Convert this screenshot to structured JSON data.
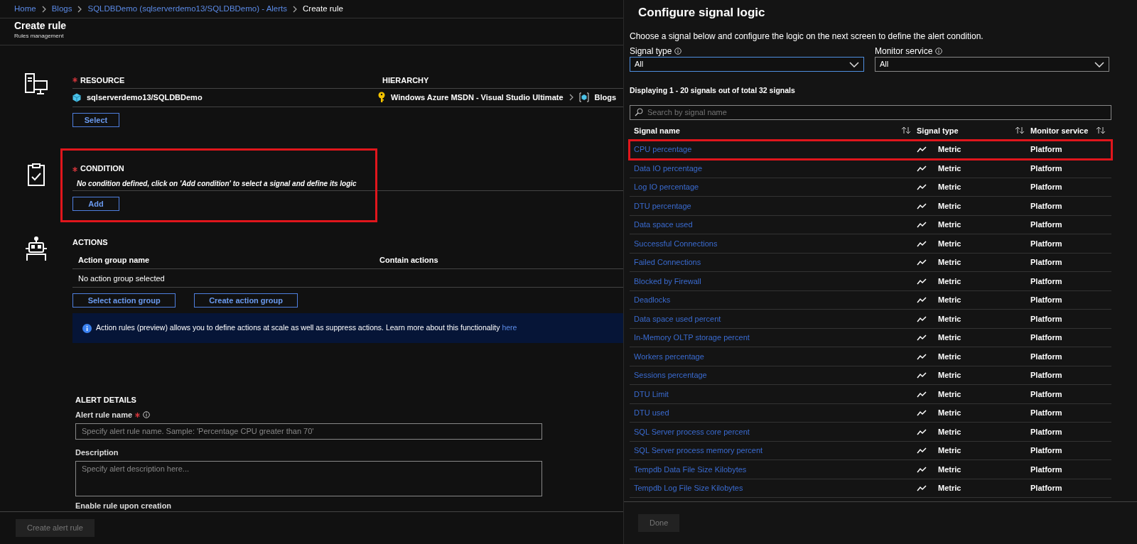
{
  "breadcrumb": [
    {
      "label": "Home",
      "current": false
    },
    {
      "label": "Blogs",
      "current": false
    },
    {
      "label": "SQLDBDemo (sqlserverdemo13/SQLDBDemo) - Alerts",
      "current": false
    },
    {
      "label": "Create rule",
      "current": true
    }
  ],
  "page": {
    "title": "Create rule",
    "subtitle": "Rules management"
  },
  "resource": {
    "heading": "RESOURCE",
    "required": true,
    "hierarchy_heading": "HIERARCHY",
    "name": "sqlserverdemo13/SQLDBDemo",
    "hierarchy": [
      "Windows Azure MSDN - Visual Studio Ultimate",
      "Blogs"
    ],
    "button": "Select"
  },
  "condition": {
    "heading": "CONDITION",
    "required": true,
    "message": "No condition defined, click on 'Add condition' to select a signal and define its logic",
    "button": "Add",
    "highlighted": true
  },
  "actions": {
    "heading": "ACTIONS",
    "columns": [
      "Action group name",
      "Contain actions"
    ],
    "empty": "No action group selected",
    "buttons": [
      "Select action group",
      "Create action group"
    ],
    "info": {
      "text": "Action rules (preview) allows you to define actions at scale as well as suppress actions. Learn more about this functionality",
      "link": "here"
    }
  },
  "alert_details": {
    "heading": "ALERT DETAILS",
    "fields": [
      {
        "kind": "input",
        "label": "Alert rule name",
        "required": true,
        "info": true,
        "placeholder": "Specify alert rule name. Sample: 'Percentage CPU greater than 70'"
      },
      {
        "kind": "textarea",
        "label": "Description",
        "required": false,
        "info": false,
        "placeholder": "Specify alert description here..."
      }
    ],
    "next_label": "Enable rule upon creation"
  },
  "footer": {
    "button": "Create alert rule",
    "disabled": true
  },
  "panel": {
    "title": "Configure signal logic",
    "description": "Choose a signal below and configure the logic on the next screen to define the alert condition.",
    "filters": [
      {
        "label": "Signal type",
        "info": true,
        "value": "All",
        "focused": true
      },
      {
        "label": "Monitor service",
        "info": true,
        "value": "All",
        "focused": false
      }
    ],
    "count": "Displaying 1 - 20 signals out of total 32 signals",
    "search": {
      "placeholder": "Search by signal name"
    },
    "columns": [
      {
        "label": "Signal name",
        "sortable": true
      },
      {
        "label": "Signal type",
        "sortable": true
      },
      {
        "label": "Monitor service",
        "sortable": true
      }
    ],
    "rows": [
      {
        "name": "CPU percentage",
        "type": "Metric",
        "service": "Platform",
        "highlighted": true
      },
      {
        "name": "Data IO percentage",
        "type": "Metric",
        "service": "Platform",
        "highlighted": false
      },
      {
        "name": "Log IO percentage",
        "type": "Metric",
        "service": "Platform",
        "highlighted": false
      },
      {
        "name": "DTU percentage",
        "type": "Metric",
        "service": "Platform",
        "highlighted": false
      },
      {
        "name": "Data space used",
        "type": "Metric",
        "service": "Platform",
        "highlighted": false
      },
      {
        "name": "Successful Connections",
        "type": "Metric",
        "service": "Platform",
        "highlighted": false
      },
      {
        "name": "Failed Connections",
        "type": "Metric",
        "service": "Platform",
        "highlighted": false
      },
      {
        "name": "Blocked by Firewall",
        "type": "Metric",
        "service": "Platform",
        "highlighted": false
      },
      {
        "name": "Deadlocks",
        "type": "Metric",
        "service": "Platform",
        "highlighted": false
      },
      {
        "name": "Data space used percent",
        "type": "Metric",
        "service": "Platform",
        "highlighted": false
      },
      {
        "name": "In-Memory OLTP storage percent",
        "type": "Metric",
        "service": "Platform",
        "highlighted": false
      },
      {
        "name": "Workers percentage",
        "type": "Metric",
        "service": "Platform",
        "highlighted": false
      },
      {
        "name": "Sessions percentage",
        "type": "Metric",
        "service": "Platform",
        "highlighted": false
      },
      {
        "name": "DTU Limit",
        "type": "Metric",
        "service": "Platform",
        "highlighted": false
      },
      {
        "name": "DTU used",
        "type": "Metric",
        "service": "Platform",
        "highlighted": false
      },
      {
        "name": "SQL Server process core percent",
        "type": "Metric",
        "service": "Platform",
        "highlighted": false
      },
      {
        "name": "SQL Server process memory percent",
        "type": "Metric",
        "service": "Platform",
        "highlighted": false
      },
      {
        "name": "Tempdb Data File Size Kilobytes",
        "type": "Metric",
        "service": "Platform",
        "highlighted": false
      },
      {
        "name": "Tempdb Log File Size Kilobytes",
        "type": "Metric",
        "service": "Platform",
        "highlighted": false
      }
    ],
    "done": {
      "label": "Done",
      "disabled": true
    }
  }
}
